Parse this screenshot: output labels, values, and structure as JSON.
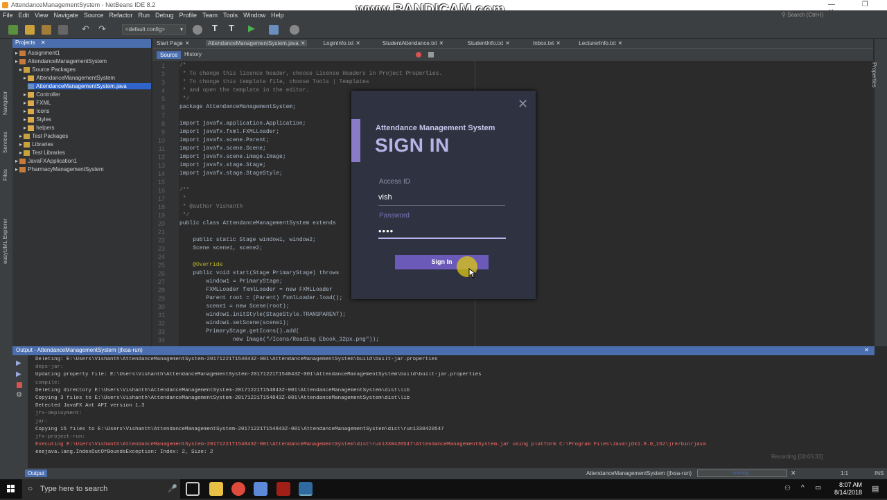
{
  "window": {
    "title": "AttendanceManagementSystem - NetBeans IDE 8.2",
    "controls": "— ❐ ✕"
  },
  "watermark": "www.BANDICAM.com",
  "menu": [
    "File",
    "Edit",
    "View",
    "Navigate",
    "Source",
    "Refactor",
    "Run",
    "Debug",
    "Profile",
    "Team",
    "Tools",
    "Window",
    "Help"
  ],
  "search": {
    "placeholder": "Search (Ctrl+I)"
  },
  "toolbar": {
    "config": "<default config>"
  },
  "sidebar_labels": [
    "Navigator",
    "Services",
    "Files",
    "easyUML Explorer"
  ],
  "projects": {
    "header": "Projects",
    "items": [
      {
        "label": "Assignment1",
        "level": 0,
        "type": "project"
      },
      {
        "label": "AttendanceManagementSystem",
        "level": 0,
        "type": "project"
      },
      {
        "label": "Source Packages",
        "level": 1,
        "type": "folder"
      },
      {
        "label": "AttendanceManagementSystem",
        "level": 2,
        "type": "package"
      },
      {
        "label": "AttendanceManagementSystem.java",
        "level": 3,
        "type": "java",
        "selected": true
      },
      {
        "label": "Controller",
        "level": 2,
        "type": "package"
      },
      {
        "label": "FXML",
        "level": 2,
        "type": "package"
      },
      {
        "label": "Icons",
        "level": 2,
        "type": "package"
      },
      {
        "label": "Styles",
        "level": 2,
        "type": "package"
      },
      {
        "label": "helpers",
        "level": 2,
        "type": "package"
      },
      {
        "label": "Test Packages",
        "level": 1,
        "type": "folder"
      },
      {
        "label": "Libraries",
        "level": 1,
        "type": "folder"
      },
      {
        "label": "Test Libraries",
        "level": 1,
        "type": "folder"
      },
      {
        "label": "JavaFXApplication1",
        "level": 0,
        "type": "project"
      },
      {
        "label": "PharmacyManagementSystem",
        "level": 0,
        "type": "project"
      }
    ]
  },
  "editor": {
    "tabs": [
      "Start Page",
      "AttendanceManagementSystem.java",
      "LoginInfo.txt",
      "StudentAttendance.txt",
      "StudentInfo.txt",
      "Inbox.txt",
      "LecturerInfo.txt"
    ],
    "active_tab": "AttendanceManagementSystem.java",
    "source_label": "Source",
    "history_label": "History",
    "code": [
      {
        "n": "1",
        "t": "/*",
        "c": "cm"
      },
      {
        "n": "2",
        "t": " * To change this license header, choose License Headers in Project Properties.",
        "c": "cm"
      },
      {
        "n": "3",
        "t": " * To change this template file, choose Tools | Templates",
        "c": "cm"
      },
      {
        "n": "4",
        "t": " * and open the template in the editor.",
        "c": "cm"
      },
      {
        "n": "5",
        "t": " */",
        "c": "cm"
      },
      {
        "n": "6",
        "t": "package AttendanceManagementSystem;",
        "c": ""
      },
      {
        "n": "7",
        "t": "",
        "c": ""
      },
      {
        "n": "8",
        "t": "import javafx.application.Application;",
        "c": ""
      },
      {
        "n": "9",
        "t": "import javafx.fxml.FXMLLoader;",
        "c": ""
      },
      {
        "n": "10",
        "t": "import javafx.scene.Parent;",
        "c": ""
      },
      {
        "n": "11",
        "t": "import javafx.scene.Scene;",
        "c": ""
      },
      {
        "n": "12",
        "t": "import javafx.scene.image.Image;",
        "c": ""
      },
      {
        "n": "13",
        "t": "import javafx.stage.Stage;",
        "c": ""
      },
      {
        "n": "14",
        "t": "import javafx.stage.StageStyle;",
        "c": ""
      },
      {
        "n": "15",
        "t": "",
        "c": ""
      },
      {
        "n": "16",
        "t": "/**",
        "c": "cm"
      },
      {
        "n": "17",
        "t": " *",
        "c": "cm"
      },
      {
        "n": "18",
        "t": " * @author Vishanth",
        "c": "cm"
      },
      {
        "n": "19",
        "t": " */",
        "c": "cm"
      },
      {
        "n": "20",
        "t": "public class AttendanceManagementSystem extends",
        "c": ""
      },
      {
        "n": "21",
        "t": "",
        "c": ""
      },
      {
        "n": "22",
        "t": "    public static Stage window1, window2;",
        "c": ""
      },
      {
        "n": "23",
        "t": "    Scene scene1, scene2;",
        "c": ""
      },
      {
        "n": "24",
        "t": "",
        "c": ""
      },
      {
        "n": "25",
        "t": "    @Override",
        "c": "an"
      },
      {
        "n": "26",
        "t": "    public void start(Stage PrimaryStage) throws",
        "c": ""
      },
      {
        "n": "27",
        "t": "        window1 = PrimaryStage;",
        "c": ""
      },
      {
        "n": "28",
        "t": "        FXMLLoader fxmlLoader = new FXMLLoader",
        "c": ""
      },
      {
        "n": "29",
        "t": "        Parent root = (Parent) fxmlLoader.load();",
        "c": ""
      },
      {
        "n": "30",
        "t": "        scene1 = new Scene(root);",
        "c": ""
      },
      {
        "n": "31",
        "t": "        window1.initStyle(StageStyle.TRANSPARENT);",
        "c": ""
      },
      {
        "n": "32",
        "t": "        window1.setScene(scene1);",
        "c": ""
      },
      {
        "n": "33",
        "t": "        PrimaryStage.getIcons().add(",
        "c": ""
      },
      {
        "n": "34",
        "t": "                new Image(\"/Icons/Reading Ebook_32px.png\"));",
        "c": ""
      }
    ]
  },
  "dialog": {
    "subtitle": "Attendance Management System",
    "title": "SIGN IN",
    "access_label": "Access ID",
    "access_value": "vish",
    "password_label": "Password",
    "password_value": "••••",
    "button": "Sign In",
    "close": "✕"
  },
  "output": {
    "header": "Output - AttendanceManagementSystem (jfxsa-run)",
    "lines": [
      {
        "t": "Deleting: E:\\Users\\Vishanth\\AttendanceManagementSystem-20171221T154843Z-001\\AttendanceManagementSystem\\build\\built-jar.properties",
        "c": "o-n"
      },
      {
        "t": "deps-jar:",
        "c": "o-c"
      },
      {
        "t": "Updating property file: E:\\Users\\Vishanth\\AttendanceManagementSystem-20171221T154843Z-001\\AttendanceManagementSystem\\build\\built-jar.properties",
        "c": "o-n"
      },
      {
        "t": "compile:",
        "c": "o-c"
      },
      {
        "t": "Deleting directory E:\\Users\\Vishanth\\AttendanceManagementSystem-20171221T154843Z-001\\AttendanceManagementSystem\\dist\\lib",
        "c": "o-n"
      },
      {
        "t": "Copying 3 files to E:\\Users\\Vishanth\\AttendanceManagementSystem-20171221T154843Z-001\\AttendanceManagementSystem\\dist\\lib",
        "c": "o-n"
      },
      {
        "t": "Detected JavaFX Ant API version 1.3",
        "c": "o-n"
      },
      {
        "t": "jfx-deployment:",
        "c": "o-c"
      },
      {
        "t": "jar:",
        "c": "o-c"
      },
      {
        "t": "Copying 15 files to E:\\Users\\Vishanth\\AttendanceManagementSystem-20171221T154843Z-001\\AttendanceManagementSystem\\dist\\run1330420547",
        "c": "o-n"
      },
      {
        "t": "jfx-project-run:",
        "c": "o-c"
      },
      {
        "t": "Executing E:\\Users\\Vishanth\\AttendanceManagementSystem-20171221T154843Z-001\\AttendanceManagementSystem\\dist\\run1330420547\\AttendanceManagementSystem.jar using platform C:\\Program Files\\Java\\jdk1.8.0_152\\jre/bin/java",
        "c": "o-e"
      },
      {
        "t": "eeejava.lang.IndexOutOfBoundsException: Index: 2, Size: 2",
        "c": "o-n"
      }
    ]
  },
  "statusbar": {
    "output_tab": "Output",
    "run_info": "AttendanceManagementSystem (jfxsa-run)",
    "progress": "running...",
    "position": "1:1",
    "mode": "INS",
    "recording": "Recording [00:05:33]"
  },
  "taskbar": {
    "search_placeholder": "Type here to search",
    "time": "8:07 AM",
    "date": "8/14/2018"
  },
  "colors": {
    "accent": "#4b6eaf",
    "dialog_bg": "#2f3341",
    "dialog_accent": "#8a7bc9",
    "signin_button": "#6c5ab8"
  }
}
